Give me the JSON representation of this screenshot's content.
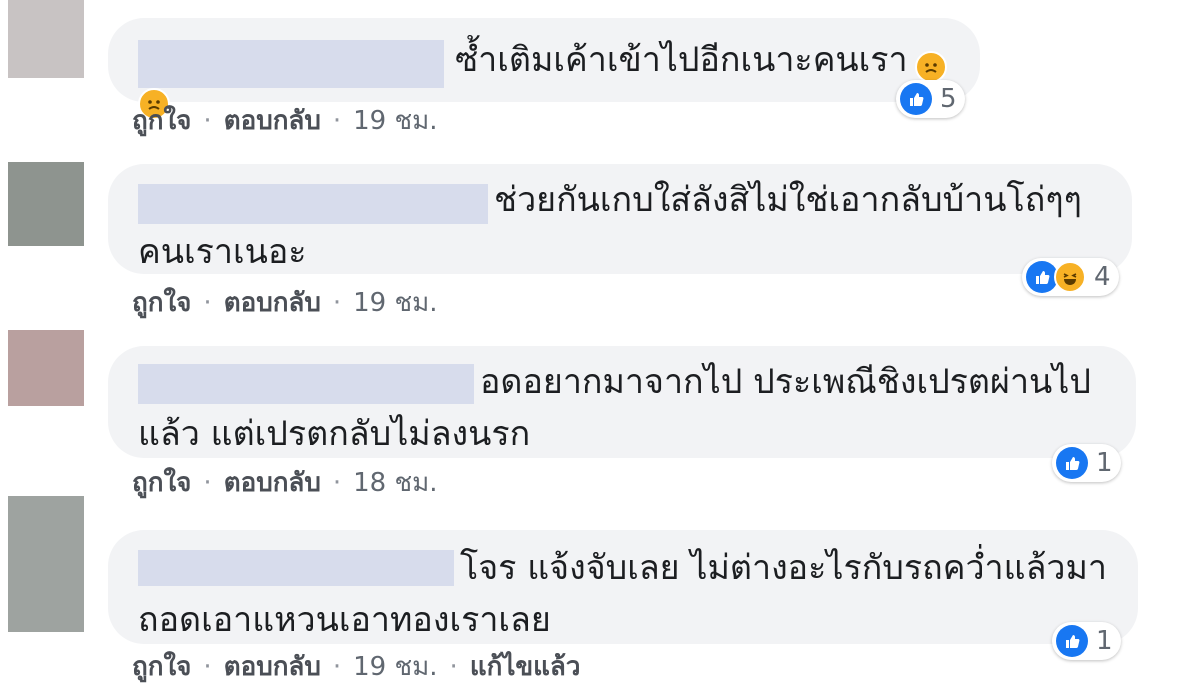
{
  "comments": [
    {
      "text": "ซ้ำเติมเค้าเข้าไปอีกเนาะคนเรา",
      "reaction_count": "5",
      "actions": {
        "like": "ถูกใจ",
        "reply": "ตอบกลับ",
        "time": "19 ชม."
      }
    },
    {
      "text": "ช่วยกันเกบใส่ลังสิไม่ใช่เอากลับบ้านโถ่ๆๆ\nคนเราเนอะ",
      "reaction_count": "4",
      "actions": {
        "like": "ถูกใจ",
        "reply": "ตอบกลับ",
        "time": "19 ชม."
      }
    },
    {
      "text": "อดอยากมาจากไป ประเพณีชิงเปรตผ่านไป\nแล้ว แต่เปรตกลับไม่ลงนรก",
      "reaction_count": "1",
      "actions": {
        "like": "ถูกใจ",
        "reply": "ตอบกลับ",
        "time": "18 ชม."
      }
    },
    {
      "text": "โจร แจ้งจับเลย ไม่ต่างอะไรกับรถคว่ำแล้วมา\nถอดเอาแหวนเอาทองเราเลย",
      "reaction_count": "1",
      "actions": {
        "like": "ถูกใจ",
        "reply": "ตอบกลับ",
        "time": "19 ชม.",
        "edited": "แก้ไขแล้ว"
      }
    }
  ],
  "colors": {
    "bubble": "#f2f3f5",
    "redaction": "#d7dcec",
    "like_blue": "#1877f2",
    "emoji_yellow": "#f7b125"
  },
  "icons": [
    "like-icon",
    "sad-icon",
    "haha-icon"
  ]
}
